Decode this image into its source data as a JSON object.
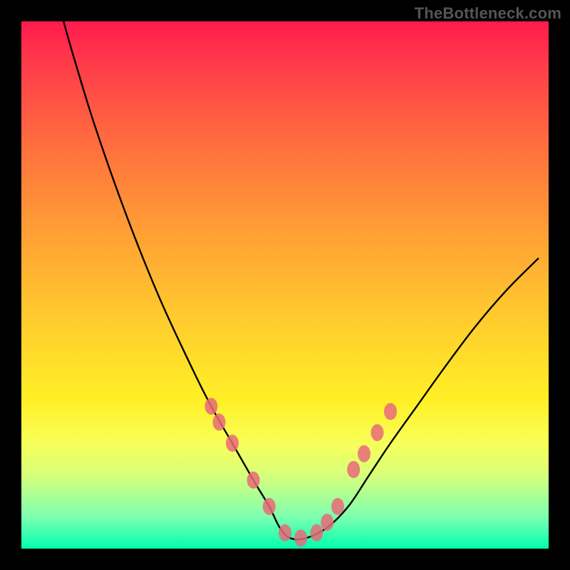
{
  "watermark": "TheBottleneck.com",
  "chart_data": {
    "type": "line",
    "title": "",
    "xlabel": "",
    "ylabel": "",
    "xlim": [
      0,
      100
    ],
    "ylim": [
      0,
      100
    ],
    "series": [
      {
        "name": "curve",
        "x": [
          8,
          10,
          14,
          20,
          26,
          32,
          36,
          40,
          44,
          47,
          49,
          51,
          54,
          58,
          62,
          66,
          70,
          75,
          80,
          86,
          92,
          98
        ],
        "values": [
          100,
          93,
          80,
          63,
          48,
          35,
          27,
          20,
          13,
          8,
          4,
          2,
          2,
          4,
          8,
          14,
          20,
          27,
          34,
          42,
          49,
          55
        ]
      }
    ],
    "markers": {
      "name": "dots",
      "color": "#e96a78",
      "x": [
        36,
        37.5,
        40,
        44,
        47,
        50,
        53,
        56,
        58,
        60,
        63,
        65,
        67.5,
        70
      ],
      "values": [
        27,
        24,
        20,
        13,
        8,
        3,
        2,
        3,
        5,
        8,
        15,
        18,
        22,
        26
      ]
    }
  }
}
